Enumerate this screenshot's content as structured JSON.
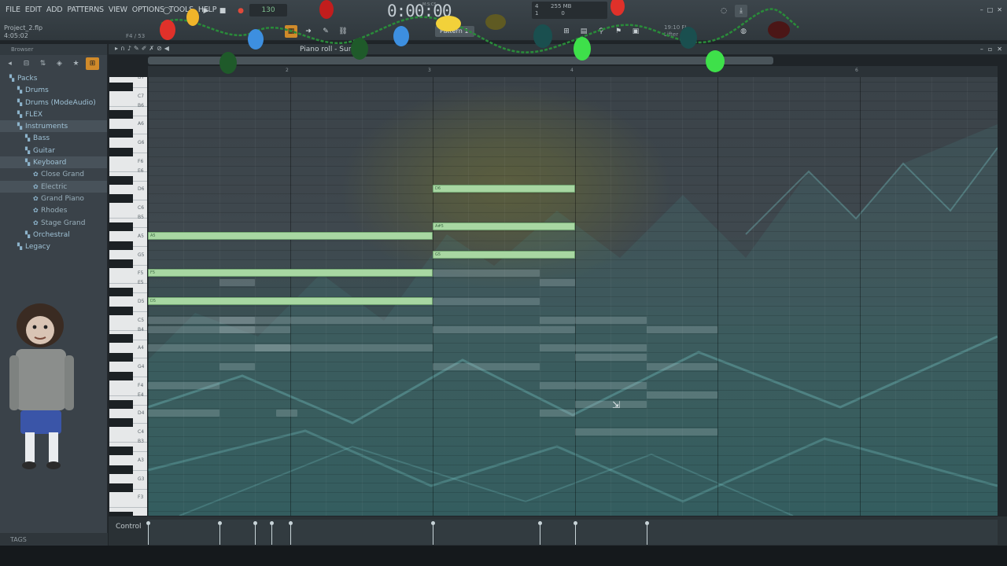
{
  "menu": [
    "FILE",
    "EDIT",
    "ADD",
    "PATTERNS",
    "VIEW",
    "OPTIONS",
    "TOOLS",
    "HELP"
  ],
  "project": {
    "name": "Project_2.flp",
    "time": "4:05:02",
    "position": "F4 / 53"
  },
  "transport": {
    "tempo": "130",
    "timecode": "0:00:00",
    "mscs": "M:S:CS",
    "cpu_a": "255 MB",
    "cpu_b": "0",
    "cpu_c": "1",
    "cpu_d": "4"
  },
  "pattern": {
    "label": "Pattern 1"
  },
  "hint": {
    "line1": "19:10  FL",
    "line2": "Lifter"
  },
  "browser": {
    "header": "Browser",
    "items": [
      {
        "label": "Packs",
        "level": 0,
        "type": "folder"
      },
      {
        "label": "Drums",
        "level": 1,
        "type": "folder"
      },
      {
        "label": "Drums (ModeAudio)",
        "level": 1,
        "type": "folder"
      },
      {
        "label": "FLEX",
        "level": 1,
        "type": "folder"
      },
      {
        "label": "Instruments",
        "level": 1,
        "type": "folder",
        "selected": true
      },
      {
        "label": "Bass",
        "level": 2,
        "type": "folder"
      },
      {
        "label": "Guitar",
        "level": 2,
        "type": "folder"
      },
      {
        "label": "Keyboard",
        "level": 2,
        "type": "folder",
        "selected": true
      },
      {
        "label": "Close Grand",
        "level": 3,
        "type": "preset"
      },
      {
        "label": "Electric",
        "level": 3,
        "type": "preset",
        "selected": true
      },
      {
        "label": "Grand Piano",
        "level": 3,
        "type": "preset"
      },
      {
        "label": "Rhodes",
        "level": 3,
        "type": "preset"
      },
      {
        "label": "Stage Grand",
        "level": 3,
        "type": "preset"
      },
      {
        "label": "Orchestral",
        "level": 2,
        "type": "folder"
      },
      {
        "label": "Legacy",
        "level": 1,
        "type": "folder"
      }
    ],
    "tags_label": "TAGS"
  },
  "piano_roll": {
    "title": "Piano roll - Surge",
    "bar_numbers": [
      "2",
      "3",
      "4",
      "5",
      "6"
    ],
    "key_labels": [
      "D7",
      "C7",
      "B6",
      "A6",
      "G6",
      "F6",
      "E6",
      "D6",
      "C6",
      "B5",
      "A5",
      "G5",
      "F5",
      "E5",
      "D5",
      "C5",
      "B4",
      "A4",
      "G4",
      "F4",
      "E4",
      "D4",
      "C4",
      "B3",
      "A3",
      "G3",
      "F3"
    ],
    "notes": [
      {
        "label": "A5",
        "pitch": "A5",
        "start": 0,
        "length": 2
      },
      {
        "label": "F5",
        "pitch": "F5",
        "start": 0,
        "length": 2
      },
      {
        "label": "D5",
        "pitch": "D5",
        "start": 0,
        "length": 2
      },
      {
        "label": "D6",
        "pitch": "D6",
        "start": 2,
        "length": 1
      },
      {
        "label": "A#5",
        "pitch": "A#5",
        "start": 2,
        "length": 1
      },
      {
        "label": "G5",
        "pitch": "G5",
        "start": 2,
        "length": 1
      }
    ],
    "control_label": "Control"
  }
}
